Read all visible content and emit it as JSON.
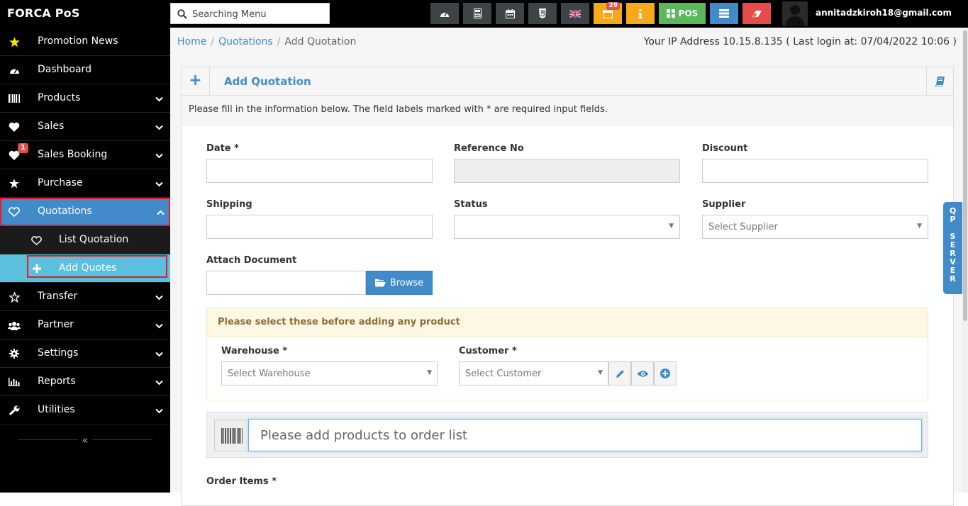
{
  "app": {
    "brand": "FORCA PoS"
  },
  "search": {
    "placeholder": "Searching Menu"
  },
  "toolbar": {
    "notification_count": "29",
    "pos_label": "POS",
    "user_email": "annitadzkiroh18@gmail.com"
  },
  "sidebar": {
    "items": [
      {
        "label": "Promotion News",
        "icon": "star-icon"
      },
      {
        "label": "Dashboard",
        "icon": "dashboard-icon"
      },
      {
        "label": "Products",
        "icon": "barcode-icon"
      },
      {
        "label": "Sales",
        "icon": "heart-icon"
      },
      {
        "label": "Sales Booking",
        "icon": "heart-icon",
        "badge": "1"
      },
      {
        "label": "Purchase",
        "icon": "star-icon"
      },
      {
        "label": "Quotations",
        "icon": "heart-outline-icon"
      },
      {
        "label": "List Quotation",
        "icon": "heart-outline-icon"
      },
      {
        "label": "Add Quotes",
        "icon": "plus-icon"
      },
      {
        "label": "Transfer",
        "icon": "star-outline-icon"
      },
      {
        "label": "Partner",
        "icon": "users-icon"
      },
      {
        "label": "Settings",
        "icon": "cog-icon"
      },
      {
        "label": "Reports",
        "icon": "bar-chart-icon"
      },
      {
        "label": "Utilities",
        "icon": "wrench-icon"
      }
    ],
    "collapse_glyph": "«"
  },
  "breadcrumb": {
    "home": "Home",
    "parent": "Quotations",
    "current": "Add Quotation"
  },
  "ip_info": "Your IP Address 10.15.8.135 ( Last login at: 07/04/2022 10:06 )",
  "form": {
    "title": "Add Quotation",
    "intro": "Please fill in the information below. The field labels marked with * are required input fields.",
    "date_label": "Date *",
    "reference_label": "Reference No",
    "discount_label": "Discount",
    "shipping_label": "Shipping",
    "status_label": "Status",
    "supplier_label": "Supplier",
    "supplier_placeholder": "Select Supplier",
    "attach_label": "Attach Document",
    "browse_label": "Browse",
    "notice": "Please select these before adding any product",
    "warehouse_label": "Warehouse *",
    "warehouse_placeholder": "Select Warehouse",
    "customer_label": "Customer *",
    "customer_placeholder": "Select Customer",
    "add_products_placeholder": "Please add products to order list",
    "order_items_label": "Order Items *"
  },
  "side_tab": {
    "label": "QP SERVER"
  },
  "colors": {
    "primary": "#428bca",
    "highlight": "#e41b23",
    "sub_active": "#5bc0de"
  }
}
